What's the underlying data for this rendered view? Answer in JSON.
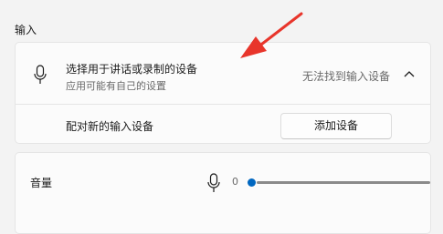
{
  "section": {
    "title": "输入"
  },
  "input_device": {
    "icon": "microphone-icon",
    "title": "选择用于讲话或录制的设备",
    "subtitle": "应用可能有自己的设置",
    "status": "无法找到输入设备",
    "expand_icon": "chevron-up-icon"
  },
  "pair_device": {
    "label": "配对新的输入设备",
    "button_label": "添加设备"
  },
  "volume": {
    "label": "音量",
    "icon": "microphone-icon",
    "value": "0",
    "level_percent": 0
  },
  "annotation": {
    "icon": "red-arrow",
    "color": "#e8352b"
  },
  "colors": {
    "accent": "#0067c0",
    "background": "#f3f3f3",
    "card": "#fbfbfb"
  }
}
